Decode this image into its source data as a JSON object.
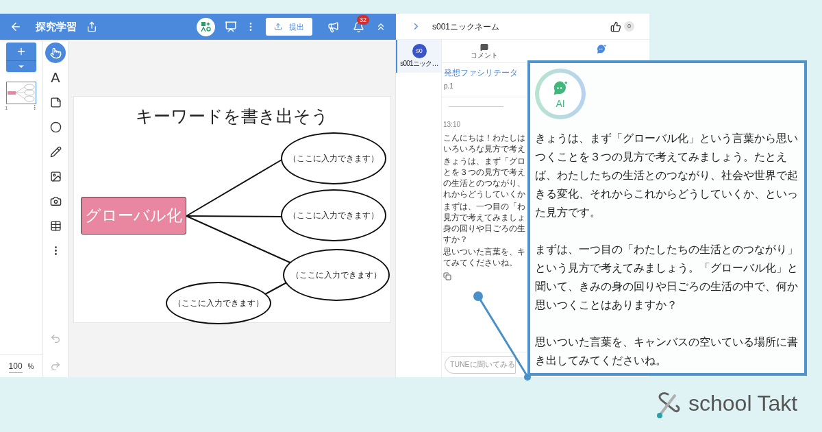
{
  "editor": {
    "header": {
      "title": "探究学習",
      "submit_label": "提出",
      "notification_count": "32"
    },
    "page_thumbnail": {
      "number": "1",
      "selected": true
    },
    "tools": [
      {
        "kind": "hand",
        "selected": true
      },
      {
        "kind": "text",
        "glyph": "A",
        "selected": false
      },
      {
        "kind": "note",
        "selected": false
      },
      {
        "kind": "circle",
        "selected": false
      },
      {
        "kind": "pencil",
        "selected": false
      },
      {
        "kind": "image",
        "selected": false
      },
      {
        "kind": "camera",
        "selected": false
      },
      {
        "kind": "table",
        "selected": false
      },
      {
        "kind": "more",
        "selected": false
      }
    ],
    "history": {
      "undo_disabled": true,
      "redo_disabled": true
    },
    "zoom": {
      "value": "100",
      "unit": "%"
    },
    "slide": {
      "title": "キーワードを書き出そう",
      "center": "グローバル化",
      "bubbles": [
        "（ここに入力できます）",
        "（ここに入力できます）",
        "（ここに入力できます）",
        "（ここに入力できます）"
      ]
    }
  },
  "panel": {
    "student_name": "s001ニックネーム",
    "likes": "0",
    "students": [
      {
        "avatar": "s0",
        "name": "s001ニック…",
        "selected": true
      }
    ],
    "tabs": [
      {
        "label": "コメント",
        "selected": false
      },
      {
        "kind": "ai",
        "selected": true
      }
    ],
    "session": {
      "title": "発想ファシリテータ",
      "page": "p.1"
    },
    "chat": {
      "time": "13:10",
      "paragraphs": [
        [
          "こんにちは！わたしは",
          "いろいろな見方で考え"
        ],
        [
          "きょうは、まず「グロ",
          "とを３つの見方で考え",
          "の生活とのつながり、",
          "れからどうしていくか"
        ],
        [
          "まずは、一つ目の「わ",
          "見方で考えてみましょ",
          "身の回りや日ごろの生",
          "すか？"
        ],
        [
          "思いついた言葉を、キ",
          "てみてくださいね。"
        ]
      ]
    },
    "input": {
      "placeholder": "TUNEに聞いてみる"
    }
  },
  "callout": {
    "badge": "AI",
    "paragraphs": [
      "きょうは、まず「グローバル化」という言葉から思いつくことを３つの見方で考えてみましょう。たとえば、わたしたちの生活とのつながり、社会や世界で起きる変化、それからこれからどうしていくか、といった見方です。",
      "まずは、一つ目の「わたしたちの生活とのつながり」という見方で考えてみましょう。「グローバル化」と聞いて、きみの身の回りや日ごろの生活の中で、何か思いつくことはありますか？",
      "思いついた言葉を、キャンバスの空いている場所に書き出してみてくださいね。"
    ]
  },
  "logo": {
    "text": "school",
    "text_2": "Takt"
  }
}
